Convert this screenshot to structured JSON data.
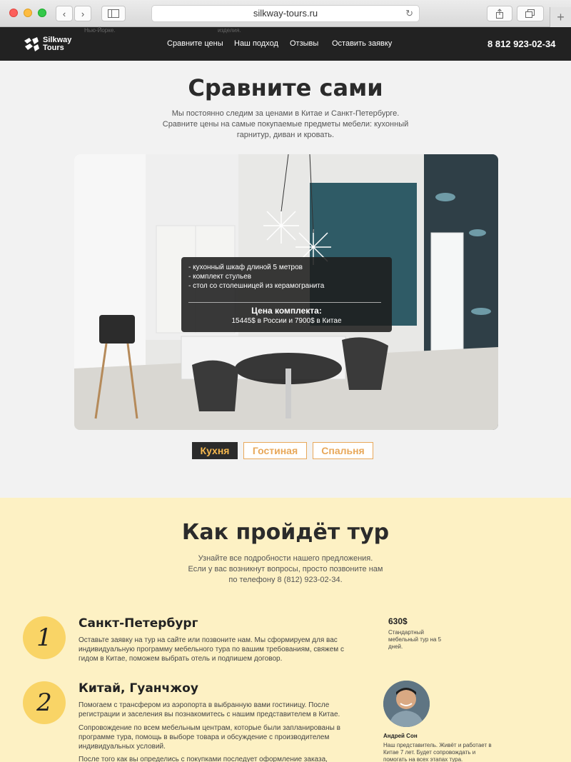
{
  "browser": {
    "url": "silkway-tours.ru"
  },
  "header": {
    "logo_line1": "Silkway",
    "logo_line2": "Tours",
    "ghost_left": "Нью-Йорке.",
    "ghost_right": "изделия.",
    "menu": [
      "Сравните цены",
      "Наш подход",
      "Отзывы",
      "Оставить заявку"
    ],
    "phone": "8 812 923-02-34"
  },
  "compare": {
    "title": "Сравните сами",
    "subtitle_lines": [
      "Мы постоянно следим за ценами в Китае и Санкт-Петербурге.",
      "Сравните цены на самые покупаемые предметы мебели: кухонный",
      "гарнитур, диван и кровать."
    ],
    "items": [
      "- кухонный шкаф длиной 5 метров",
      "- комплект стульев",
      "- стол со столешницей из керамогранита"
    ],
    "price_title": "Цена комплекта:",
    "price_text": "15445$ в России и 7900$ в Китае",
    "tabs": [
      "Кухня",
      "Гостиная",
      "Спальня"
    ],
    "active_tab": "Кухня"
  },
  "tour": {
    "title": "Как пройдёт тур",
    "subtitle_lines": [
      "Узнайте все подробности нашего предложения.",
      "Если у вас возникнут вопросы, просто позвоните нам",
      "по телефону 8 (812) 923-02-34."
    ],
    "steps": [
      {
        "number": "1",
        "title": "Санкт-Петербург",
        "paragraphs": [
          "Оставьте заявку на тур на сайте или позвоните нам. Мы сформируем для вас индивидуальную программу мебельного тура по вашим требованиям, свяжем с гидом в Китае, поможем выбрать отель и подпишем договор."
        ]
      },
      {
        "number": "2",
        "title": "Китай, Гуанчжоу",
        "paragraphs": [
          "Помогаем с трансфером из аэропорта в выбранную вами гостиницу. После регистрации и заселения вы познакомитесь с нашим представителем в Китае.",
          "Сопровождение по всем мебельным центрам, которые были запланированы в программе тура, помощь в выборе товара и обсуждение с производителем индивидуальных условий.",
          "После того как вы определись с покупками последует оформление заказа,"
        ]
      }
    ],
    "price": "630$",
    "price_note": "Стандартный мебельный тур на 5 дней.",
    "rep_name": "Андрей Сон",
    "rep_text": "Наш представитель. Живёт и работает в Китае 7 лет. Будет сопровождать и помогать на всех этапах тура."
  }
}
